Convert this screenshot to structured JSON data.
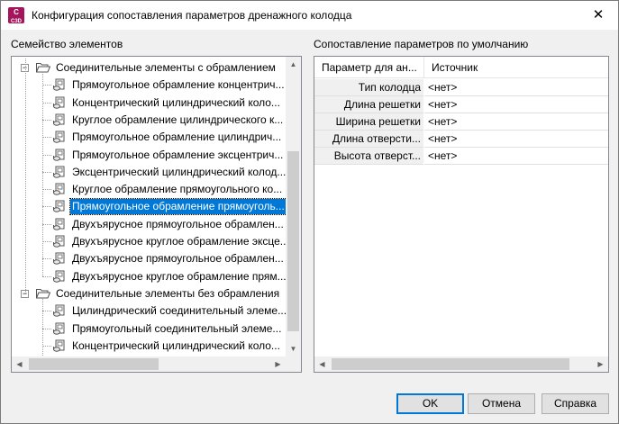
{
  "window": {
    "title": "Конфигурация сопоставления параметров дренажного колодца",
    "app_icon_text": "C\nC3D",
    "close_glyph": "✕"
  },
  "left_panel": {
    "label": "Семейство элементов",
    "tree": [
      {
        "type": "group",
        "label": "Соединительные элементы с обрамлением",
        "expanded": true
      },
      {
        "type": "item",
        "label": "Прямоугольное обрамление концентрич..."
      },
      {
        "type": "item",
        "label": "Концентрический цилиндрический коло..."
      },
      {
        "type": "item",
        "label": "Круглое обрамление цилиндрического к..."
      },
      {
        "type": "item",
        "label": "Прямоугольное обрамление цилиндрич..."
      },
      {
        "type": "item",
        "label": "Прямоугольное обрамление эксцентрич..."
      },
      {
        "type": "item",
        "label": "Эксцентрический цилиндрический колод..."
      },
      {
        "type": "item",
        "label": "Круглое обрамление прямоугольного ко..."
      },
      {
        "type": "item",
        "label": "Прямоугольное обрамление прямоуголь...",
        "selected": true
      },
      {
        "type": "item",
        "label": "Двухъярусное прямоугольное обрамлен..."
      },
      {
        "type": "item",
        "label": "Двухъярусное круглое обрамление эксце..."
      },
      {
        "type": "item",
        "label": "Двухъярусное прямоугольное обрамлен..."
      },
      {
        "type": "item",
        "label": "Двухъярусное круглое обрамление прям..."
      },
      {
        "type": "group",
        "label": "Соединительные элементы без обрамления",
        "expanded": true
      },
      {
        "type": "item",
        "label": "Цилиндрический соединительный элеме..."
      },
      {
        "type": "item",
        "label": "Прямоугольный соединительный элеме..."
      },
      {
        "type": "item",
        "label": "Концентрический цилиндрический коло..."
      }
    ]
  },
  "right_panel": {
    "label": "Сопоставление параметров по умолчанию",
    "columns": [
      "Параметр для ан...",
      "Источник"
    ],
    "rows": [
      {
        "param": "Тип колодца",
        "source": "<нет>"
      },
      {
        "param": "Длина решетки",
        "source": "<нет>"
      },
      {
        "param": "Ширина решетки",
        "source": "<нет>"
      },
      {
        "param": "Длина отверсти...",
        "source": "<нет>"
      },
      {
        "param": "Высота отверст...",
        "source": "<нет>"
      }
    ]
  },
  "buttons": {
    "ok": "OK",
    "cancel": "Отмена",
    "help": "Справка"
  }
}
